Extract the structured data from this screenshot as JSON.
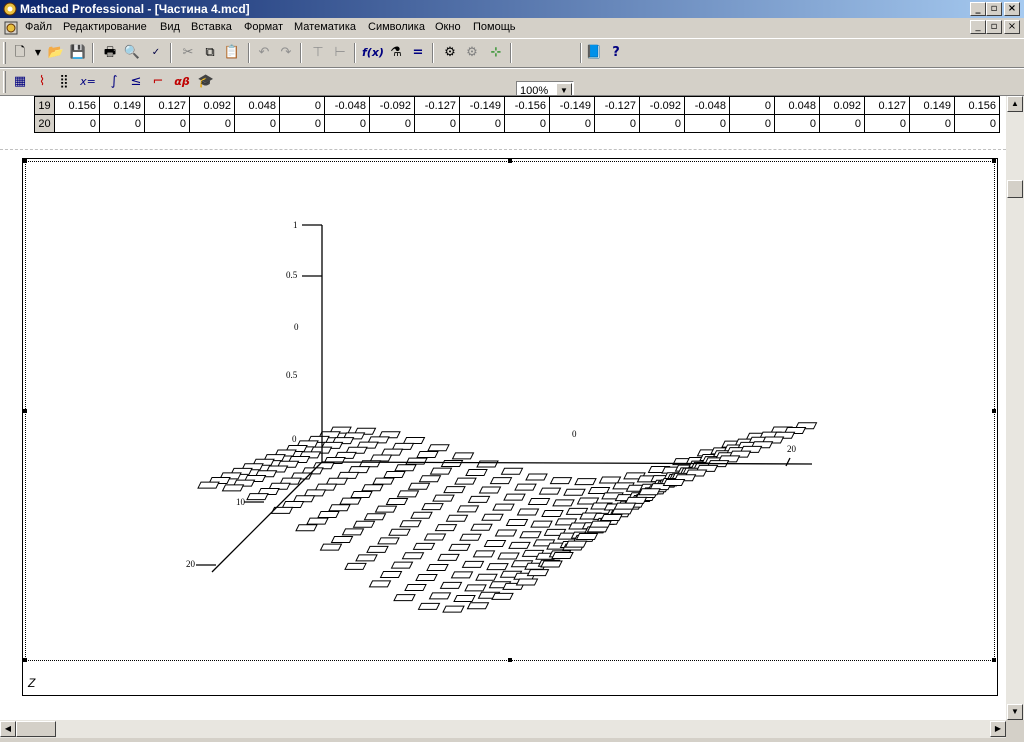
{
  "window": {
    "title": "Mathcad Professional - [Частина 4.mcd]",
    "controls": [
      "_",
      "▫",
      "×"
    ]
  },
  "menu": [
    "Файл",
    "Редактирование",
    "Вид",
    "Вставка",
    "Формат",
    "Математика",
    "Символика",
    "Окно",
    "Помощь"
  ],
  "toolbar": {
    "zoom": "100%",
    "icons": [
      "new-document-icon",
      "open-folder-icon",
      "save-icon",
      "print-icon",
      "print-preview-icon",
      "spell-check-icon",
      "cut-icon",
      "copy-icon",
      "paste-icon",
      "undo-icon",
      "redo-icon",
      "align-horizontal-icon",
      "align-vertical-icon",
      "insert-function-icon",
      "insert-unit-icon",
      "calculate-icon",
      "insert-component-icon",
      "resource-center-icon",
      "help-icon"
    ]
  },
  "math_toolbar": {
    "icons": [
      "calculator-icon",
      "graph-icon",
      "matrix-icon",
      "evaluation-icon",
      "calculus-icon",
      "boolean-icon",
      "programming-icon",
      "greek-icon",
      "symbolic-icon"
    ]
  },
  "matrix": {
    "rows": [
      {
        "index": "19",
        "values": [
          "0.156",
          "0.149",
          "0.127",
          "0.092",
          "0.048",
          "0",
          "-0.048",
          "-0.092",
          "-0.127",
          "-0.149",
          "-0.156",
          "-0.149",
          "-0.127",
          "-0.092",
          "-0.048",
          "0",
          "0.048",
          "0.092",
          "0.127",
          "0.149",
          "0.156"
        ]
      },
      {
        "index": "20",
        "values": [
          "0",
          "0",
          "0",
          "0",
          "0",
          "0",
          "0",
          "0",
          "0",
          "0",
          "0",
          "0",
          "0",
          "0",
          "0",
          "0",
          "0",
          "0",
          "0",
          "0",
          "0"
        ]
      }
    ]
  },
  "plot": {
    "z_ticks": [
      "1",
      "0.5",
      "0",
      "0.5",
      "0"
    ],
    "x_ticks": [
      "10",
      "20"
    ],
    "y_ticks": [
      "0",
      "20"
    ],
    "label": "Z"
  }
}
